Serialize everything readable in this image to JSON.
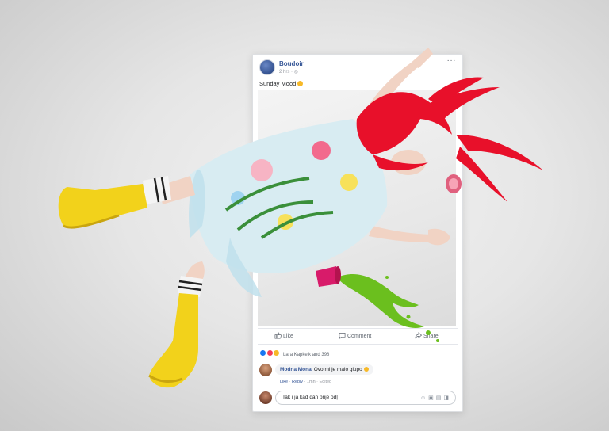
{
  "post": {
    "page_name": "Boudoir",
    "time": "2 hrs · ",
    "caption": "Sunday Mood",
    "more_label": "···"
  },
  "actions": {
    "like": "Like",
    "comment": "Comment",
    "share": "Share"
  },
  "reactions": {
    "summary": "Lara Kapkejk and 398",
    "colors": [
      "#1877f2",
      "#f33e58",
      "#f7b928"
    ]
  },
  "comment": {
    "author": "Modna Mona",
    "text": "Ovo mi je malo glupo",
    "like": "Like",
    "reply": "Reply",
    "meta_tail": " · 1mn · Edited"
  },
  "composer": {
    "value": "Tak i ja kad dan prije od",
    "icons": [
      "emoji-icon",
      "camera-icon",
      "gif-icon",
      "sticker-icon"
    ]
  },
  "colors": {
    "accent": "#385898",
    "hair": "#e8102a",
    "boots": "#f2d21b",
    "cup": "#d81b6a",
    "splash": "#6bbf1e"
  }
}
